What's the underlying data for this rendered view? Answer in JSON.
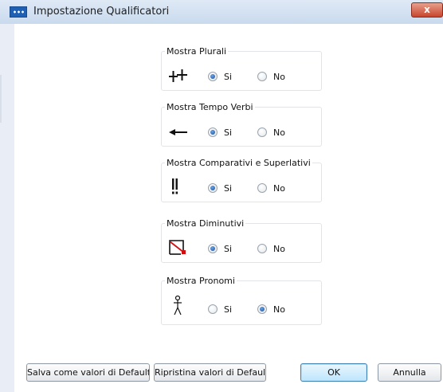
{
  "window": {
    "title": "Impostazione Qualificatori",
    "close_label": "x"
  },
  "groups": [
    {
      "label": "Mostra Plurali",
      "icon": "plural-symbol-icon",
      "options": {
        "si": "Si",
        "no": "No"
      },
      "selected": "si"
    },
    {
      "label": "Mostra Tempo Verbi",
      "icon": "past-tense-arrow-icon",
      "options": {
        "si": "Si",
        "no": "No"
      },
      "selected": "si"
    },
    {
      "label": "Mostra Comparativi e Superlativi",
      "icon": "comparative-exclamation-icon",
      "options": {
        "si": "Si",
        "no": "No"
      },
      "selected": "si"
    },
    {
      "label": "Mostra Diminutivi",
      "icon": "diminutive-symbol-icon",
      "options": {
        "si": "Si",
        "no": "No"
      },
      "selected": "si"
    },
    {
      "label": "Mostra Pronomi",
      "icon": "pronoun-person-icon",
      "options": {
        "si": "Si",
        "no": "No"
      },
      "selected": "no"
    }
  ],
  "buttons": {
    "save_default": "Salva come valori di Default",
    "restore_default": "Ripristina valori di Default",
    "ok": "OK",
    "cancel": "Annulla"
  },
  "colors": {
    "accent": "#1d4f9c",
    "close_button": "#c7452e",
    "diminutive_red": "#d01010"
  }
}
